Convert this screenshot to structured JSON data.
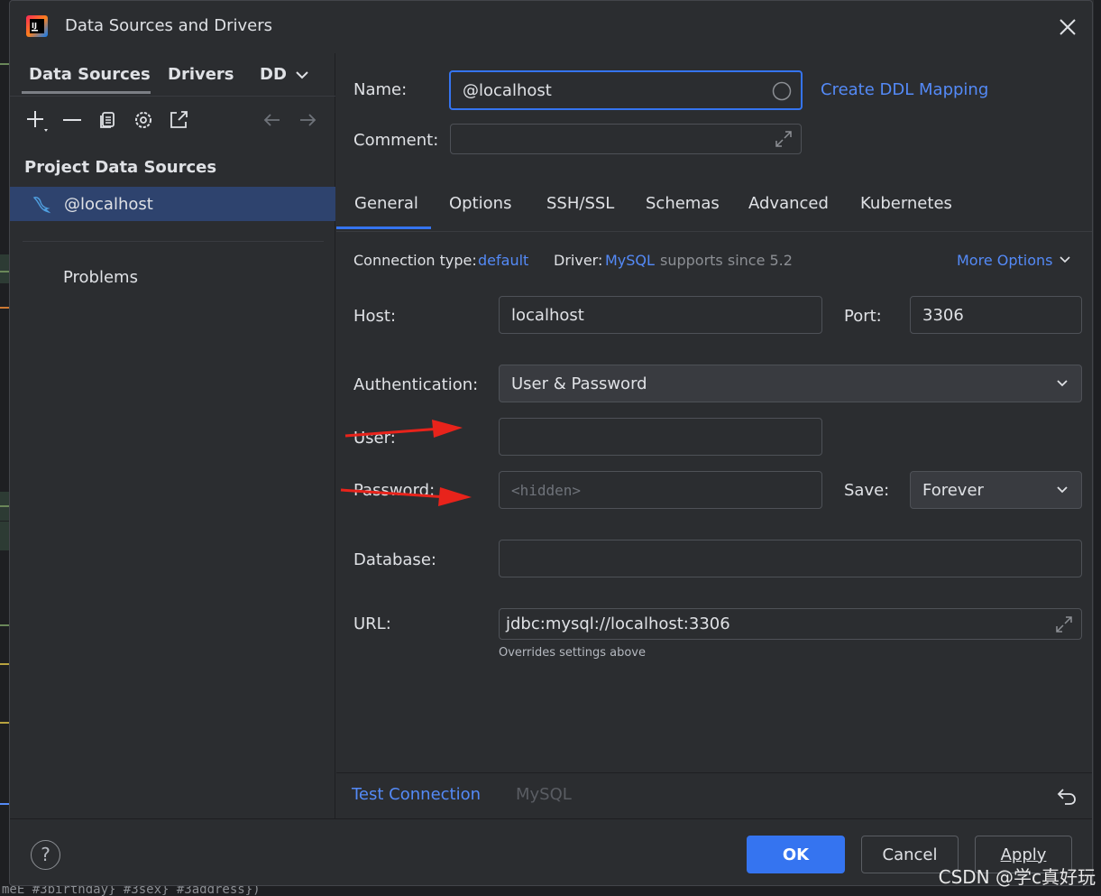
{
  "window": {
    "title": "Data Sources and Drivers"
  },
  "left_panel": {
    "tabs": [
      {
        "label": "Data Sources"
      },
      {
        "label": "Drivers"
      },
      {
        "label": "DD"
      }
    ],
    "section_title": "Project Data Sources",
    "data_sources": [
      {
        "label": "@localhost"
      }
    ],
    "problems_label": "Problems"
  },
  "form": {
    "name_label": "Name:",
    "name_value": "@localhost",
    "create_ddl_link": "Create DDL Mapping",
    "comment_label": "Comment:",
    "comment_value": ""
  },
  "tabs": [
    {
      "label": "General"
    },
    {
      "label": "Options"
    },
    {
      "label": "SSH/SSL"
    },
    {
      "label": "Schemas"
    },
    {
      "label": "Advanced"
    },
    {
      "label": "Kubernetes"
    }
  ],
  "general": {
    "connection_type_label": "Connection type:",
    "connection_type_value": "default",
    "driver_label": "Driver:",
    "driver_value": "MySQL",
    "driver_note": "supports since 5.2",
    "more_options": "More Options",
    "host_label": "Host:",
    "host_value": "localhost",
    "port_label": "Port:",
    "port_value": "3306",
    "auth_label": "Authentication:",
    "auth_value": "User & Password",
    "user_label": "User:",
    "user_value": "",
    "password_label": "Password:",
    "password_placeholder": "<hidden>",
    "save_label": "Save:",
    "save_value": "Forever",
    "database_label": "Database:",
    "database_value": "",
    "url_label": "URL:",
    "url_value": "jdbc:mysql://localhost:3306",
    "url_note": "Overrides settings above"
  },
  "footer": {
    "test_connection": "Test Connection",
    "driver_name": "MySQL"
  },
  "buttons": {
    "help": "?",
    "ok": "OK",
    "cancel": "Cancel",
    "apply": "Apply"
  },
  "watermark": "CSDN @学c真好玩",
  "background_code": "meE #3birthday} #3sex} #3address})",
  "colors": {
    "accent": "#3574f0",
    "link": "#548af7",
    "selection": "#2e436e",
    "annotation_arrow": "#e8231b"
  },
  "icons": [
    "jetbrains-logo-icon",
    "close-icon",
    "chevron-down-icon",
    "add-icon",
    "remove-icon",
    "duplicate-icon",
    "settings-icon",
    "navigate-icon",
    "back-arrow-icon",
    "forward-arrow-icon",
    "mysql-dolphin-icon",
    "circle-icon",
    "expand-icon",
    "undo-icon"
  ]
}
